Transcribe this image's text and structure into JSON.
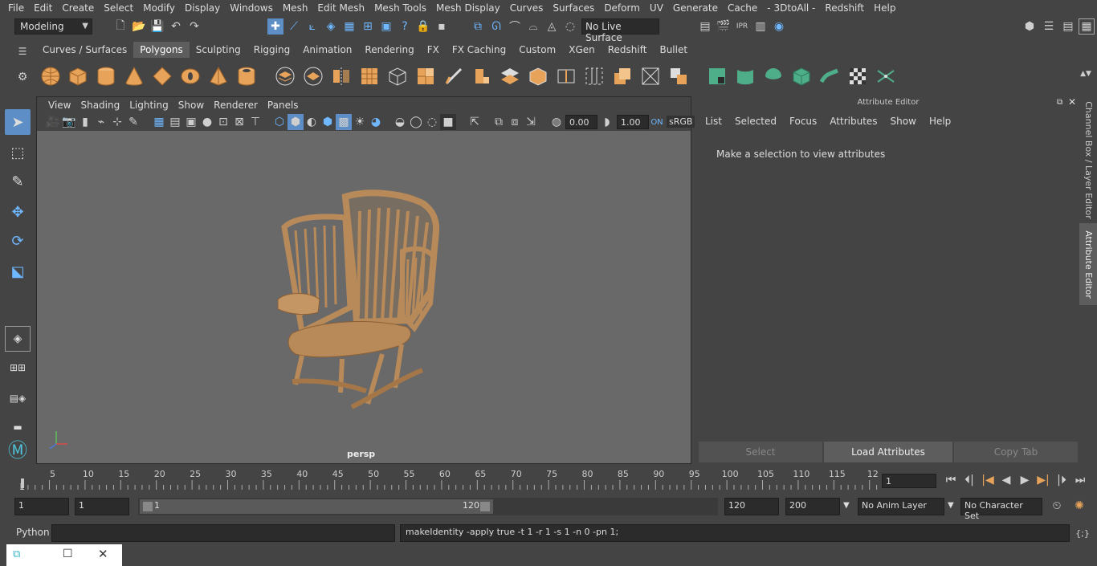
{
  "menubar": [
    "File",
    "Edit",
    "Create",
    "Select",
    "Modify",
    "Display",
    "Windows",
    "Mesh",
    "Edit Mesh",
    "Mesh Tools",
    "Mesh Display",
    "Curves",
    "Surfaces",
    "Deform",
    "UV",
    "Generate",
    "Cache",
    "- 3DtoAll -",
    "Redshift",
    "Help"
  ],
  "status": {
    "mode": "Modeling",
    "live_surface": "No Live Surface"
  },
  "shelf": {
    "tabs": [
      "Curves / Surfaces",
      "Polygons",
      "Sculpting",
      "Rigging",
      "Animation",
      "Rendering",
      "FX",
      "FX Caching",
      "Custom",
      "XGen",
      "Redshift",
      "Bullet"
    ],
    "active": "Polygons"
  },
  "viewport": {
    "menu": [
      "View",
      "Shading",
      "Lighting",
      "Show",
      "Renderer",
      "Panels"
    ],
    "exposure": "0.00",
    "gamma": "1.00",
    "colorspace": "sRGB",
    "camera": "persp"
  },
  "attribute_editor": {
    "title": "Attribute Editor",
    "menu": [
      "List",
      "Selected",
      "Focus",
      "Attributes",
      "Show",
      "Help"
    ],
    "message": "Make a selection to view attributes",
    "buttons": {
      "select": "Select",
      "load": "Load Attributes",
      "copy": "Copy Tab"
    }
  },
  "side_tabs": {
    "channel_box": "Channel Box / Layer Editor",
    "attribute_editor": "Attribute Editor"
  },
  "timeline": {
    "ticks": [
      "5",
      "10",
      "15",
      "20",
      "25",
      "30",
      "35",
      "40",
      "45",
      "50",
      "55",
      "60",
      "65",
      "70",
      "75",
      "80",
      "85",
      "90",
      "95",
      "100",
      "105",
      "110",
      "115",
      "12"
    ],
    "start_label": "1",
    "current_frame": "1"
  },
  "range": {
    "start": "1",
    "playback_start": "1",
    "slider_start": "1",
    "slider_end": "120",
    "end": "120",
    "anim_end": "200",
    "anim_layer": "No Anim Layer",
    "character_set": "No Character Set"
  },
  "command": {
    "language": "Python",
    "input": "",
    "result": "makeIdentity -apply true -t 1 -r 1 -s 1 -n 0 -pn 1;"
  },
  "colors": {
    "bg": "#444444",
    "viewport": "#696969",
    "accent": "#5d8fc6",
    "wood": "#b88a5a",
    "shelf_orange": "#e8a35a",
    "shelf_green": "#4fae8a"
  }
}
